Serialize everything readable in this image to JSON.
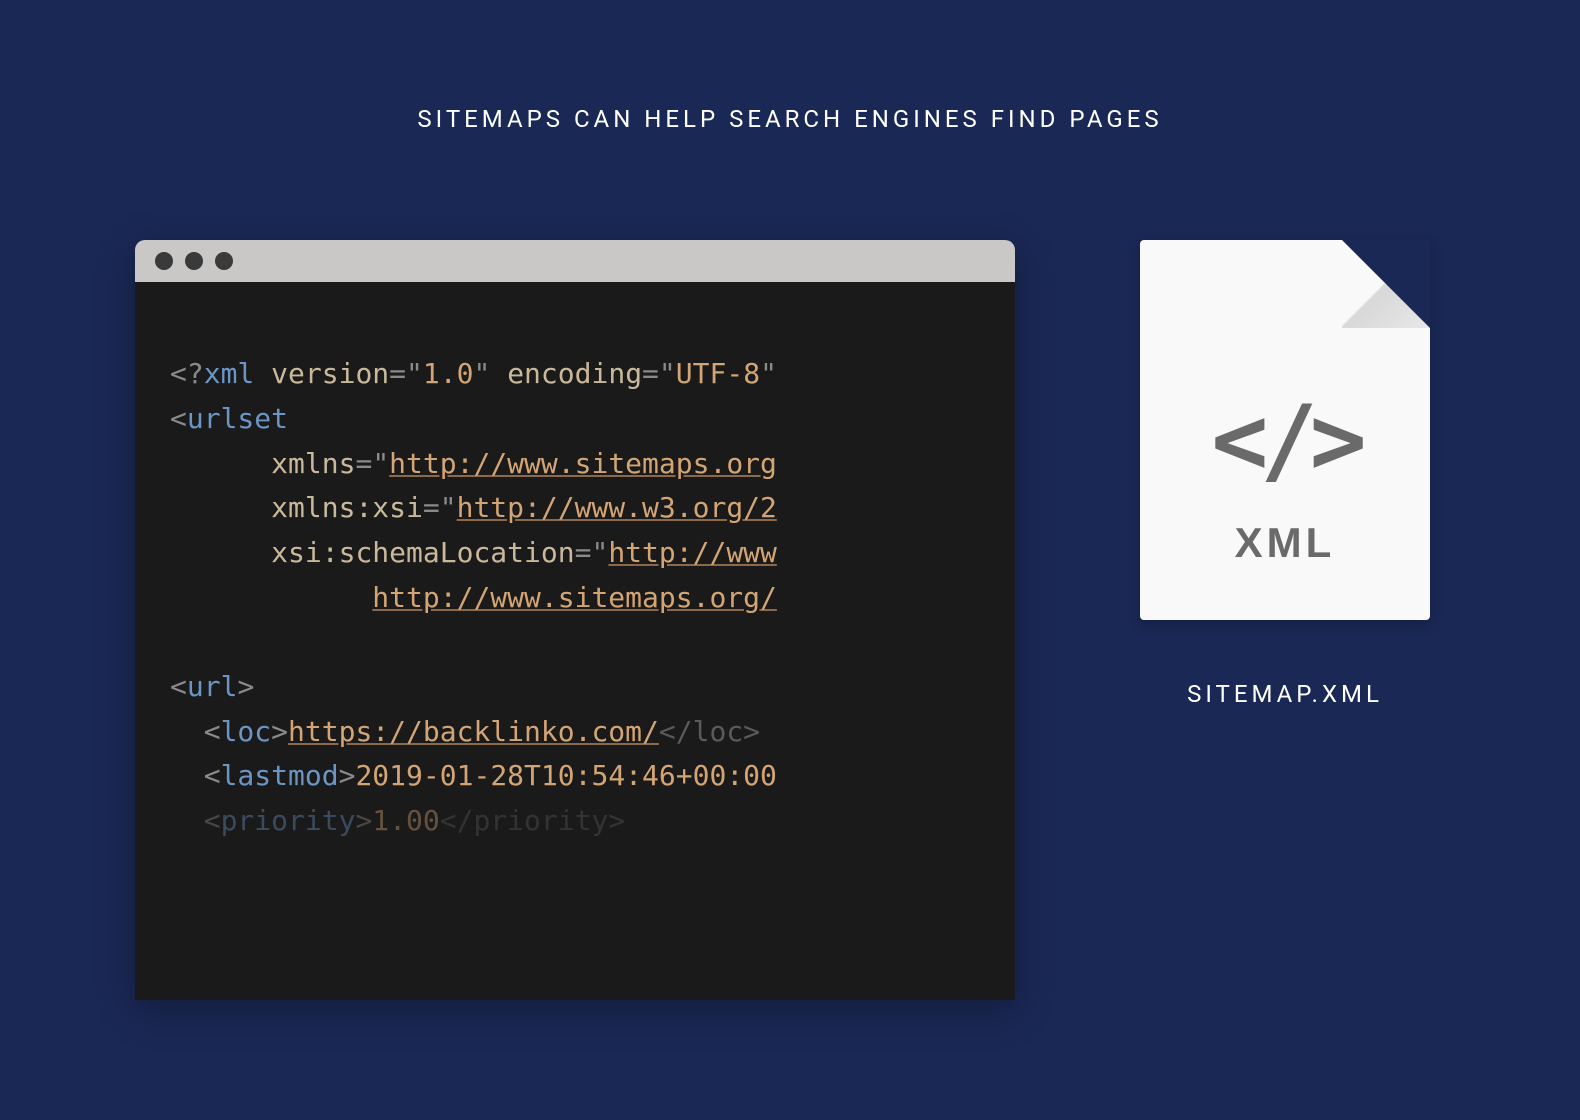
{
  "title": "SITEMAPS CAN HELP SEARCH ENGINES FIND PAGES",
  "code": {
    "xml_version": "1.0",
    "xml_encoding": "UTF-8",
    "urlset_tag": "urlset",
    "xmlns_attr": "xmlns",
    "xmlns_val": "http://www.sitemaps.org",
    "xmlns_xsi_attr": "xmlns:xsi",
    "xmlns_xsi_val": "http://www.w3.org/2",
    "schema_attr": "xsi:schemaLocation",
    "schema_val1": "http://www",
    "schema_val2": "http://www.sitemaps.org/",
    "url_tag": "url",
    "loc_tag": "loc",
    "loc_val": "https://backlinko.com/",
    "lastmod_tag": "lastmod",
    "lastmod_val": "2019-01-28T10:54:46+00:00",
    "priority_tag": "priority",
    "priority_val": "1.00"
  },
  "file": {
    "glyph": "</>",
    "ext": "XML",
    "label": "SITEMAP.XML"
  }
}
